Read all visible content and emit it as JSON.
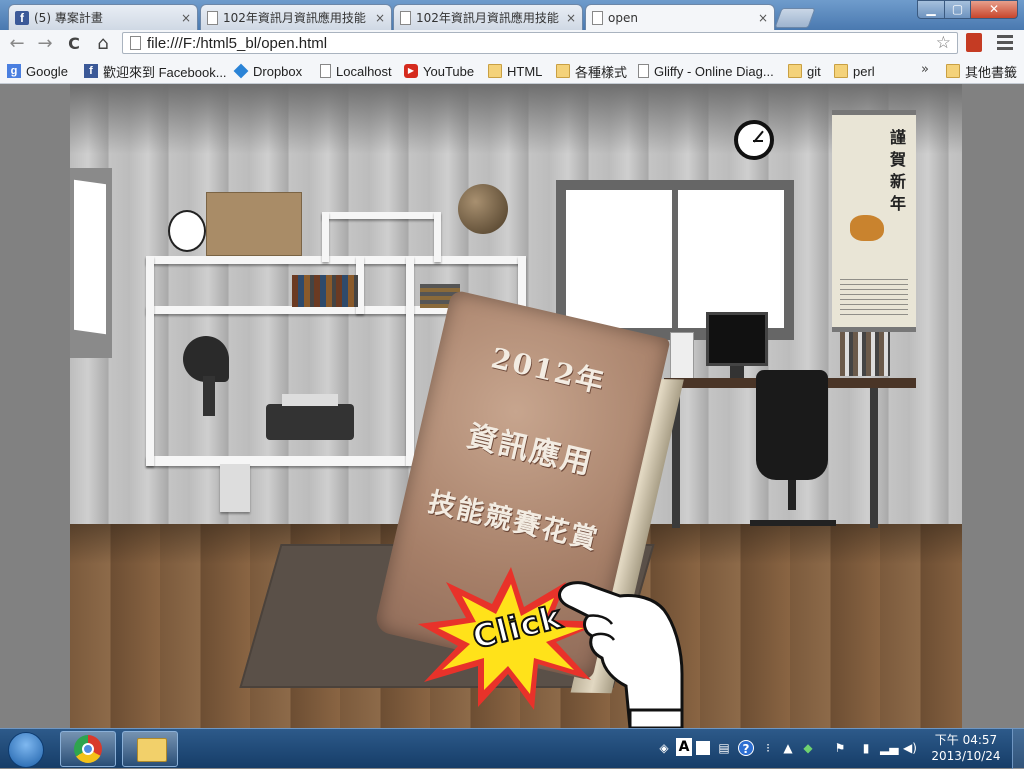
{
  "tabs": [
    {
      "title": "(5) 專案計畫",
      "favicon": "facebook-icon",
      "active": false
    },
    {
      "title": "102年資訊月資訊應用技能",
      "favicon": "page-icon",
      "active": false
    },
    {
      "title": "102年資訊月資訊應用技能",
      "favicon": "page-icon",
      "active": false
    },
    {
      "title": "open",
      "favicon": "page-icon",
      "active": true
    }
  ],
  "tab_close_glyph": "×",
  "window_buttons": {
    "minimize": "▁",
    "maximize": "▢",
    "close": "✕"
  },
  "nav": {
    "back": "←",
    "forward": "→",
    "reload": "C",
    "home": "⌂"
  },
  "address_bar": {
    "url": "file:///F:/html5_bl/open.html",
    "star": "☆"
  },
  "bookmarks": [
    {
      "label": "Google",
      "icon": "google-icon"
    },
    {
      "label": "歡迎來到 Facebook...",
      "icon": "facebook-icon"
    },
    {
      "label": "Dropbox",
      "icon": "dropbox-icon"
    },
    {
      "label": "Localhost",
      "icon": "page-icon"
    },
    {
      "label": "YouTube",
      "icon": "youtube-icon"
    },
    {
      "label": "HTML",
      "icon": "folder-icon"
    },
    {
      "label": "各種樣式",
      "icon": "folder-icon"
    },
    {
      "label": "Gliffy - Online Diag...",
      "icon": "page-icon"
    },
    {
      "label": "git",
      "icon": "folder-icon"
    },
    {
      "label": "perl",
      "icon": "folder-icon"
    }
  ],
  "bookmarks_overflow": "»",
  "other_bookmarks": "其他書籤",
  "page": {
    "scroll_title": "謹賀新年",
    "book_lines": [
      "2012年",
      "資訊應用",
      "技能競賽花賞"
    ],
    "click_label": "Click"
  },
  "taskbar": {
    "time": "下午 04:57",
    "date": "2013/10/24",
    "ime_label": "A",
    "help_glyph": "?"
  },
  "colors": {
    "burst_outer": "#e8322a",
    "burst_inner": "#ffe21a",
    "taskbar": "#1f4a78"
  }
}
